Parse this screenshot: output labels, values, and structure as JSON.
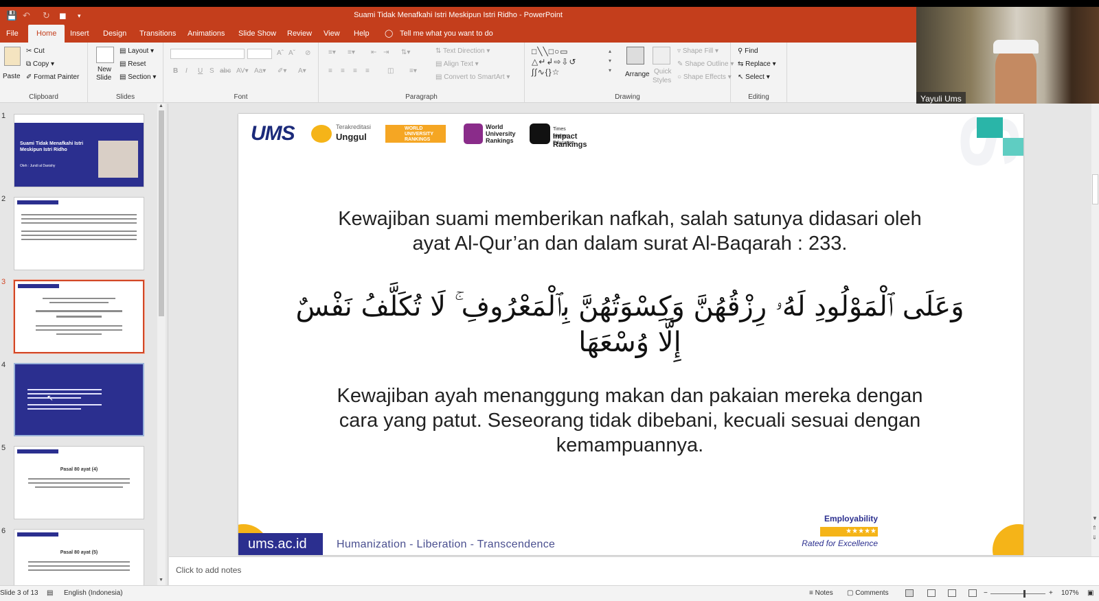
{
  "window": {
    "title": "Suami Tidak Menafkahi Istri Meskipun Istri Ridho  -  PowerPoint"
  },
  "tabs": [
    "File",
    "Home",
    "Insert",
    "Design",
    "Transitions",
    "Animations",
    "Slide Show",
    "Review",
    "View",
    "Help"
  ],
  "active_tab": "Home",
  "tell_me": "Tell me what you want to do",
  "ribbon": {
    "clipboard": {
      "label": "Clipboard",
      "paste": "Paste",
      "cut": "Cut",
      "copy": "Copy",
      "format_painter": "Format Painter"
    },
    "slides": {
      "label": "Slides",
      "new_slide": "New",
      "new_slide2": "Slide",
      "layout": "Layout",
      "reset": "Reset",
      "section": "Section"
    },
    "font": {
      "label": "Font",
      "bold": "B",
      "italic": "I",
      "underline": "U",
      "strike": "S",
      "shadow": "abc"
    },
    "paragraph": {
      "label": "Paragraph",
      "text_direction": "Text Direction",
      "align_text": "Align Text",
      "convert_smartart": "Convert to SmartArt"
    },
    "drawing": {
      "label": "Drawing",
      "arrange": "Arrange",
      "quick_styles": "Quick",
      "quick_styles2": "Styles",
      "shape_fill": "Shape Fill",
      "shape_outline": "Shape Outline",
      "shape_effects": "Shape Effects"
    },
    "editing": {
      "label": "Editing",
      "find": "Find",
      "replace": "Replace",
      "select": "Select"
    }
  },
  "webcam": {
    "name": "Yayuli Ums"
  },
  "thumbnails": [
    {
      "num": "1",
      "title": "Suami Tidak Menafkahi Istri Meskipun Istri Ridho",
      "sub": "Oleh : Jundi al Danishy"
    },
    {
      "num": "2"
    },
    {
      "num": "3"
    },
    {
      "num": "4"
    },
    {
      "num": "5",
      "title": "Pasal 80 ayat (4)"
    },
    {
      "num": "6",
      "title": "Pasal 80 ayat (5)"
    }
  ],
  "slide": {
    "logo": "UMS",
    "badge_terakreditasi": "Terakreditasi",
    "badge_unggul": "Unggul",
    "badge_qs": "WORLD UNIVERSITY RANKINGS",
    "badge_the1": "World",
    "badge_the2": "University",
    "badge_the3": "Rankings",
    "badge_thi1": "Times Higher Education",
    "badge_thi2": "Impact Rankings",
    "text1_line1": "Kewajiban suami memberikan nafkah, salah satunya didasari oleh",
    "text1_line2": "ayat Al-Qur’an dan dalam surat Al-Baqarah : 233.",
    "arabic_line1": "وَعَلَى ٱلْمَوْلُودِ لَهُۥ رِزْقُهُنَّ وَكِسْوَتُهُنَّ بِٱلْمَعْرُوفِ ۚ لَا تُكَلَّفُ نَفْسٌ",
    "arabic_line2": "إِلَّا وُسْعَهَا",
    "text2_line1": "Kewajiban ayah menanggung makan dan pakaian mereka dengan",
    "text2_line2": "cara yang patut. Seseorang tidak dibebani, kecuali sesuai dengan",
    "text2_line3": "kemampuannya.",
    "site": "ums.ac.id",
    "tagline": "Humanization - Liberation - Transcendence",
    "employability": "Employability",
    "rated": "Rated for Excellence"
  },
  "notes_placeholder": "Click to add notes",
  "status": {
    "slide_of": "Slide 3 of 13",
    "language": "English (Indonesia)",
    "notes": "Notes",
    "comments": "Comments",
    "zoom": "107%"
  },
  "colors": {
    "accent": "#c43e1c",
    "ums_blue": "#2b2f8f",
    "ums_yellow": "#f5b418",
    "ums_teal": "#2ab5a8"
  }
}
